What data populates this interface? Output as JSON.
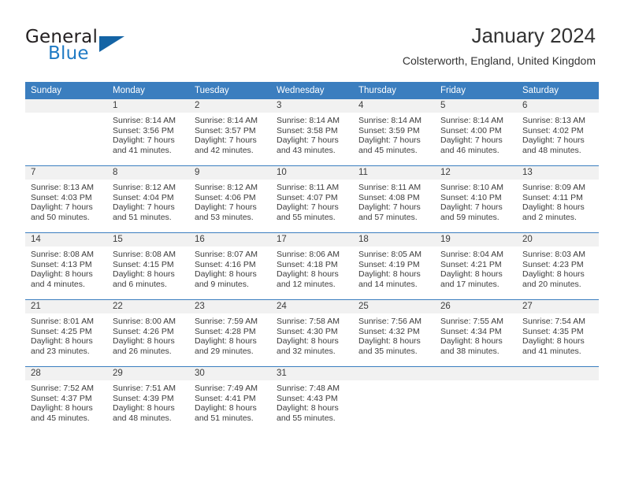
{
  "brand": {
    "name_part1": "General",
    "name_part2": "Blue",
    "triangle_icon": "triangle-icon",
    "color_dark": "#231f20",
    "color_blue": "#1f7ac4"
  },
  "header": {
    "title": "January 2024",
    "subtitle": "Colsterworth, England, United Kingdom"
  },
  "calendar": {
    "accent_color": "#3b7ebf",
    "daynum_bg": "#f1f1f1",
    "weekday_headers": [
      "Sunday",
      "Monday",
      "Tuesday",
      "Wednesday",
      "Thursday",
      "Friday",
      "Saturday"
    ],
    "labels": {
      "sunrise_prefix": "Sunrise:",
      "sunset_prefix": "Sunset:",
      "daylight_prefix": "Daylight:"
    },
    "weeks": [
      [
        {
          "day": "",
          "sunrise": "",
          "sunset": "",
          "daylight_line1": "",
          "daylight_line2": ""
        },
        {
          "day": "1",
          "sunrise": "Sunrise: 8:14 AM",
          "sunset": "Sunset: 3:56 PM",
          "daylight_line1": "Daylight: 7 hours",
          "daylight_line2": "and 41 minutes."
        },
        {
          "day": "2",
          "sunrise": "Sunrise: 8:14 AM",
          "sunset": "Sunset: 3:57 PM",
          "daylight_line1": "Daylight: 7 hours",
          "daylight_line2": "and 42 minutes."
        },
        {
          "day": "3",
          "sunrise": "Sunrise: 8:14 AM",
          "sunset": "Sunset: 3:58 PM",
          "daylight_line1": "Daylight: 7 hours",
          "daylight_line2": "and 43 minutes."
        },
        {
          "day": "4",
          "sunrise": "Sunrise: 8:14 AM",
          "sunset": "Sunset: 3:59 PM",
          "daylight_line1": "Daylight: 7 hours",
          "daylight_line2": "and 45 minutes."
        },
        {
          "day": "5",
          "sunrise": "Sunrise: 8:14 AM",
          "sunset": "Sunset: 4:00 PM",
          "daylight_line1": "Daylight: 7 hours",
          "daylight_line2": "and 46 minutes."
        },
        {
          "day": "6",
          "sunrise": "Sunrise: 8:13 AM",
          "sunset": "Sunset: 4:02 PM",
          "daylight_line1": "Daylight: 7 hours",
          "daylight_line2": "and 48 minutes."
        }
      ],
      [
        {
          "day": "7",
          "sunrise": "Sunrise: 8:13 AM",
          "sunset": "Sunset: 4:03 PM",
          "daylight_line1": "Daylight: 7 hours",
          "daylight_line2": "and 50 minutes."
        },
        {
          "day": "8",
          "sunrise": "Sunrise: 8:12 AM",
          "sunset": "Sunset: 4:04 PM",
          "daylight_line1": "Daylight: 7 hours",
          "daylight_line2": "and 51 minutes."
        },
        {
          "day": "9",
          "sunrise": "Sunrise: 8:12 AM",
          "sunset": "Sunset: 4:06 PM",
          "daylight_line1": "Daylight: 7 hours",
          "daylight_line2": "and 53 minutes."
        },
        {
          "day": "10",
          "sunrise": "Sunrise: 8:11 AM",
          "sunset": "Sunset: 4:07 PM",
          "daylight_line1": "Daylight: 7 hours",
          "daylight_line2": "and 55 minutes."
        },
        {
          "day": "11",
          "sunrise": "Sunrise: 8:11 AM",
          "sunset": "Sunset: 4:08 PM",
          "daylight_line1": "Daylight: 7 hours",
          "daylight_line2": "and 57 minutes."
        },
        {
          "day": "12",
          "sunrise": "Sunrise: 8:10 AM",
          "sunset": "Sunset: 4:10 PM",
          "daylight_line1": "Daylight: 7 hours",
          "daylight_line2": "and 59 minutes."
        },
        {
          "day": "13",
          "sunrise": "Sunrise: 8:09 AM",
          "sunset": "Sunset: 4:11 PM",
          "daylight_line1": "Daylight: 8 hours",
          "daylight_line2": "and 2 minutes."
        }
      ],
      [
        {
          "day": "14",
          "sunrise": "Sunrise: 8:08 AM",
          "sunset": "Sunset: 4:13 PM",
          "daylight_line1": "Daylight: 8 hours",
          "daylight_line2": "and 4 minutes."
        },
        {
          "day": "15",
          "sunrise": "Sunrise: 8:08 AM",
          "sunset": "Sunset: 4:15 PM",
          "daylight_line1": "Daylight: 8 hours",
          "daylight_line2": "and 6 minutes."
        },
        {
          "day": "16",
          "sunrise": "Sunrise: 8:07 AM",
          "sunset": "Sunset: 4:16 PM",
          "daylight_line1": "Daylight: 8 hours",
          "daylight_line2": "and 9 minutes."
        },
        {
          "day": "17",
          "sunrise": "Sunrise: 8:06 AM",
          "sunset": "Sunset: 4:18 PM",
          "daylight_line1": "Daylight: 8 hours",
          "daylight_line2": "and 12 minutes."
        },
        {
          "day": "18",
          "sunrise": "Sunrise: 8:05 AM",
          "sunset": "Sunset: 4:19 PM",
          "daylight_line1": "Daylight: 8 hours",
          "daylight_line2": "and 14 minutes."
        },
        {
          "day": "19",
          "sunrise": "Sunrise: 8:04 AM",
          "sunset": "Sunset: 4:21 PM",
          "daylight_line1": "Daylight: 8 hours",
          "daylight_line2": "and 17 minutes."
        },
        {
          "day": "20",
          "sunrise": "Sunrise: 8:03 AM",
          "sunset": "Sunset: 4:23 PM",
          "daylight_line1": "Daylight: 8 hours",
          "daylight_line2": "and 20 minutes."
        }
      ],
      [
        {
          "day": "21",
          "sunrise": "Sunrise: 8:01 AM",
          "sunset": "Sunset: 4:25 PM",
          "daylight_line1": "Daylight: 8 hours",
          "daylight_line2": "and 23 minutes."
        },
        {
          "day": "22",
          "sunrise": "Sunrise: 8:00 AM",
          "sunset": "Sunset: 4:26 PM",
          "daylight_line1": "Daylight: 8 hours",
          "daylight_line2": "and 26 minutes."
        },
        {
          "day": "23",
          "sunrise": "Sunrise: 7:59 AM",
          "sunset": "Sunset: 4:28 PM",
          "daylight_line1": "Daylight: 8 hours",
          "daylight_line2": "and 29 minutes."
        },
        {
          "day": "24",
          "sunrise": "Sunrise: 7:58 AM",
          "sunset": "Sunset: 4:30 PM",
          "daylight_line1": "Daylight: 8 hours",
          "daylight_line2": "and 32 minutes."
        },
        {
          "day": "25",
          "sunrise": "Sunrise: 7:56 AM",
          "sunset": "Sunset: 4:32 PM",
          "daylight_line1": "Daylight: 8 hours",
          "daylight_line2": "and 35 minutes."
        },
        {
          "day": "26",
          "sunrise": "Sunrise: 7:55 AM",
          "sunset": "Sunset: 4:34 PM",
          "daylight_line1": "Daylight: 8 hours",
          "daylight_line2": "and 38 minutes."
        },
        {
          "day": "27",
          "sunrise": "Sunrise: 7:54 AM",
          "sunset": "Sunset: 4:35 PM",
          "daylight_line1": "Daylight: 8 hours",
          "daylight_line2": "and 41 minutes."
        }
      ],
      [
        {
          "day": "28",
          "sunrise": "Sunrise: 7:52 AM",
          "sunset": "Sunset: 4:37 PM",
          "daylight_line1": "Daylight: 8 hours",
          "daylight_line2": "and 45 minutes."
        },
        {
          "day": "29",
          "sunrise": "Sunrise: 7:51 AM",
          "sunset": "Sunset: 4:39 PM",
          "daylight_line1": "Daylight: 8 hours",
          "daylight_line2": "and 48 minutes."
        },
        {
          "day": "30",
          "sunrise": "Sunrise: 7:49 AM",
          "sunset": "Sunset: 4:41 PM",
          "daylight_line1": "Daylight: 8 hours",
          "daylight_line2": "and 51 minutes."
        },
        {
          "day": "31",
          "sunrise": "Sunrise: 7:48 AM",
          "sunset": "Sunset: 4:43 PM",
          "daylight_line1": "Daylight: 8 hours",
          "daylight_line2": "and 55 minutes."
        },
        {
          "day": "",
          "sunrise": "",
          "sunset": "",
          "daylight_line1": "",
          "daylight_line2": ""
        },
        {
          "day": "",
          "sunrise": "",
          "sunset": "",
          "daylight_line1": "",
          "daylight_line2": ""
        },
        {
          "day": "",
          "sunrise": "",
          "sunset": "",
          "daylight_line1": "",
          "daylight_line2": ""
        }
      ]
    ]
  }
}
